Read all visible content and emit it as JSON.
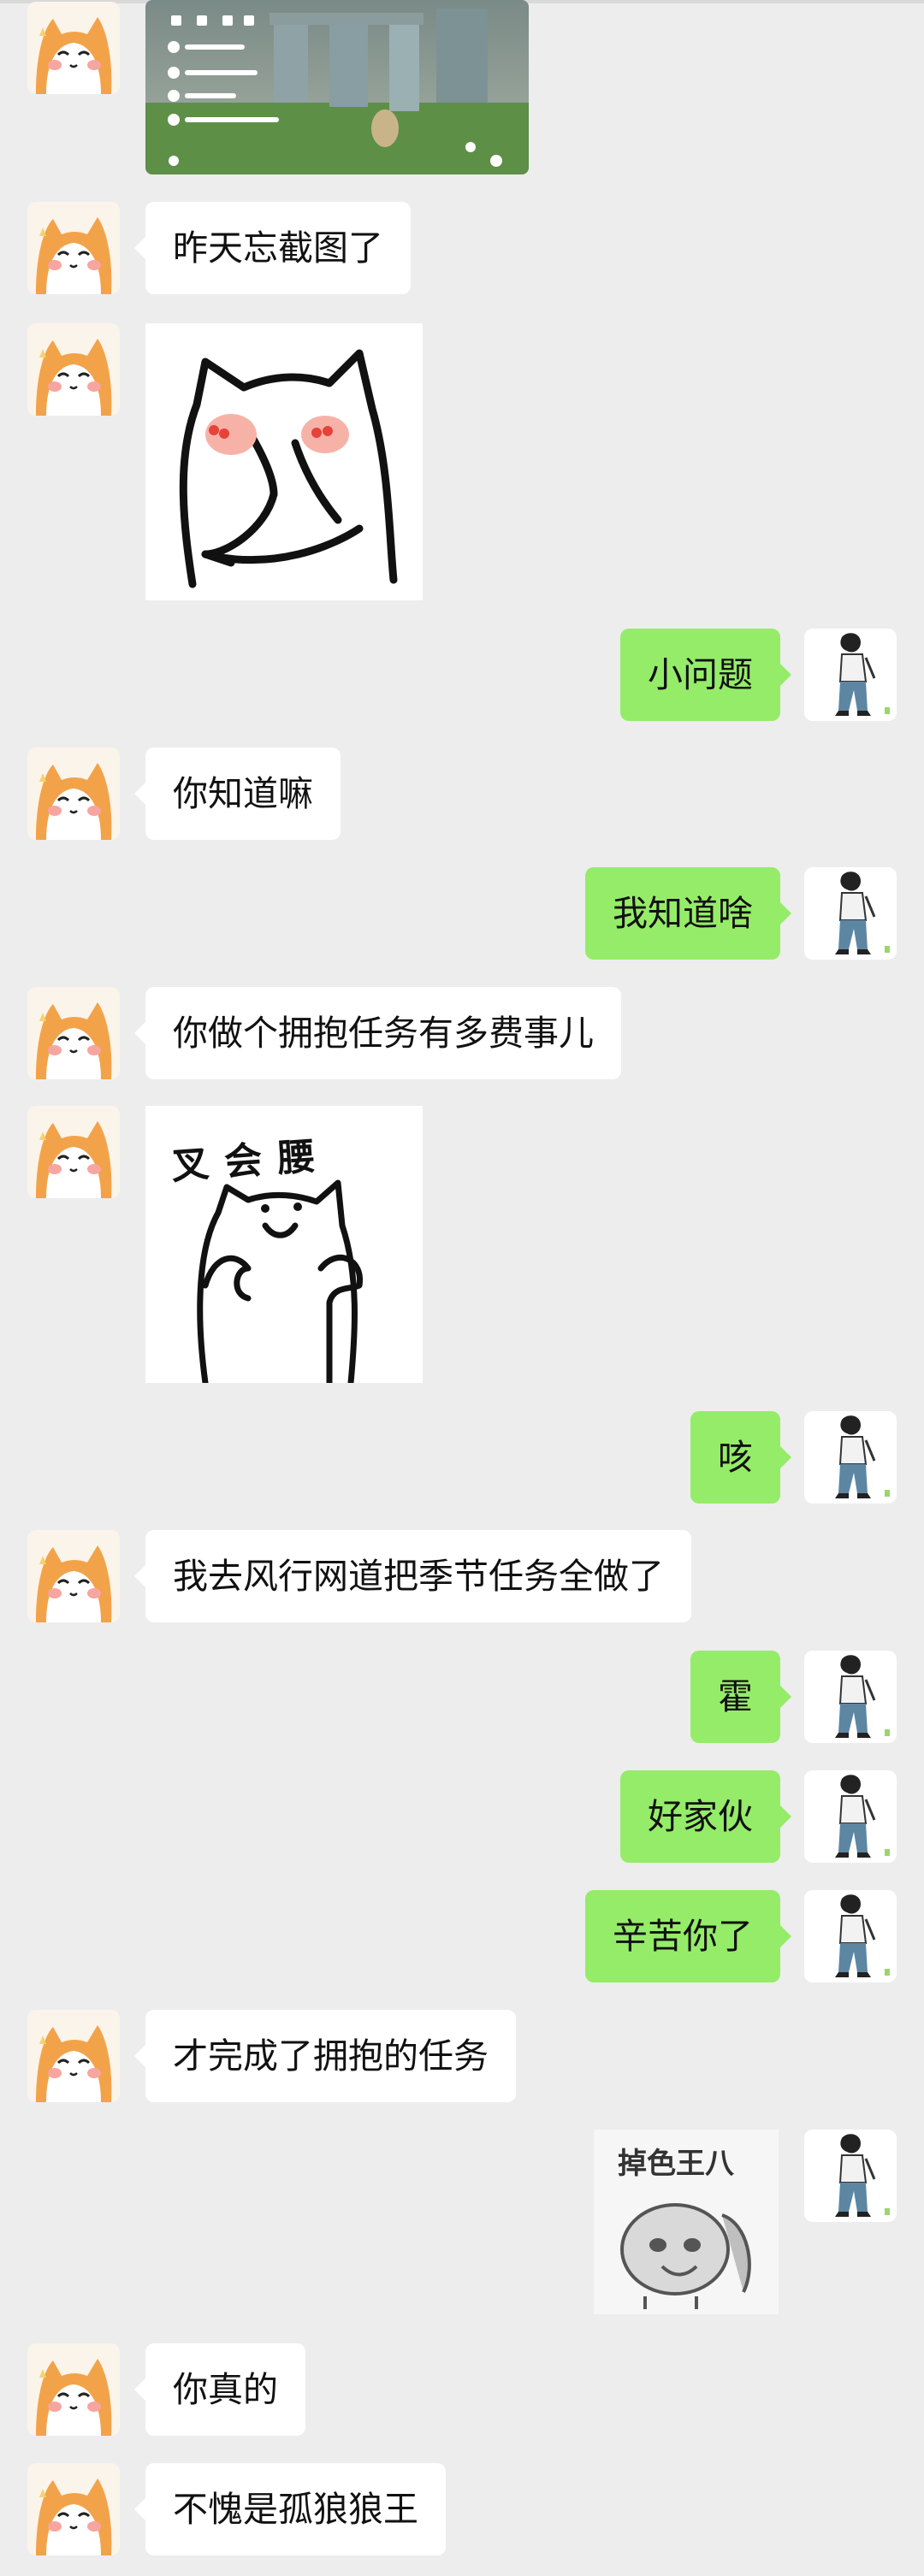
{
  "messages": [
    {
      "side": "left",
      "type": "game_screenshot"
    },
    {
      "side": "left",
      "type": "text",
      "text": "昨天忘截图了"
    },
    {
      "side": "left",
      "type": "sticker",
      "name": "cat-covering-mouth-sticker"
    },
    {
      "side": "right",
      "type": "text",
      "text": "小问题"
    },
    {
      "side": "left",
      "type": "text",
      "text": "你知道嘛"
    },
    {
      "side": "right",
      "type": "text",
      "text": "我知道啥"
    },
    {
      "side": "left",
      "type": "text",
      "text": "你做个拥抱任务有多费事儿"
    },
    {
      "side": "left",
      "type": "sticker",
      "name": "cat-hands-on-waist-sticker",
      "caption": "叉会腰"
    },
    {
      "side": "right",
      "type": "text",
      "text": "咳"
    },
    {
      "side": "left",
      "type": "text",
      "text": "我去风行网道把季节任务全做了"
    },
    {
      "side": "right",
      "type": "text",
      "text": "霍"
    },
    {
      "side": "right",
      "type": "text",
      "text": "好家伙"
    },
    {
      "side": "right",
      "type": "text",
      "text": "辛苦你了"
    },
    {
      "side": "left",
      "type": "text",
      "text": "才完成了拥抱的任务"
    },
    {
      "side": "right",
      "type": "sticker",
      "name": "fading-dog-sticker",
      "caption": "掉色王八"
    },
    {
      "side": "left",
      "type": "text",
      "text": "你真的"
    },
    {
      "side": "left",
      "type": "text",
      "text": "不愧是孤狼狼王"
    }
  ],
  "avatars": {
    "left": "shiba-dog-avatar",
    "right": "standing-boy-avatar"
  },
  "colors": {
    "background": "#ededed",
    "own_bubble": "#95ec69",
    "other_bubble": "#ffffff"
  }
}
